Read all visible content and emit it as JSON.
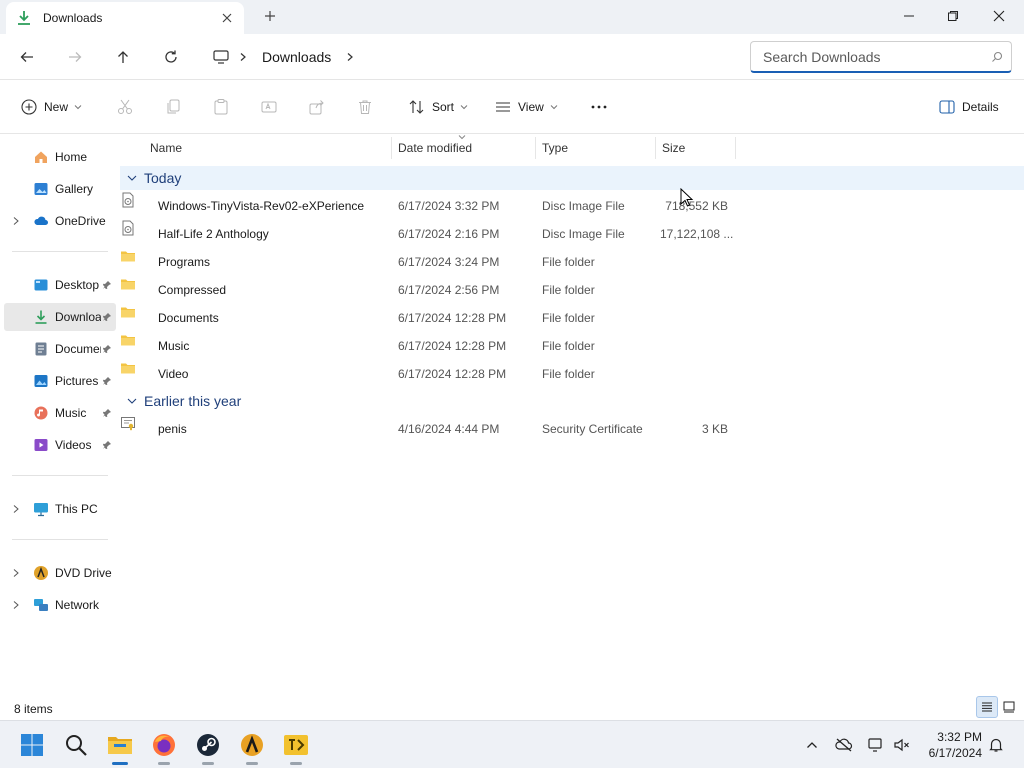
{
  "window": {
    "tab_title": "Downloads",
    "search_placeholder": "Search Downloads"
  },
  "breadcrumb": {
    "items": [
      "Downloads"
    ]
  },
  "toolbar": {
    "new_label": "New",
    "sort_label": "Sort",
    "view_label": "View",
    "details_label": "Details"
  },
  "sidebar": {
    "items": [
      {
        "label": "Home",
        "icon": "home-icon"
      },
      {
        "label": "Gallery",
        "icon": "gallery-icon"
      },
      {
        "label": "OneDrive",
        "icon": "cloud-icon"
      },
      {
        "label": "Desktop",
        "icon": "desktop-icon"
      },
      {
        "label": "Downloads",
        "icon": "download-icon"
      },
      {
        "label": "Documents",
        "icon": "documents-icon"
      },
      {
        "label": "Pictures",
        "icon": "pictures-icon"
      },
      {
        "label": "Music",
        "icon": "music-icon"
      },
      {
        "label": "Videos",
        "icon": "videos-icon"
      },
      {
        "label": "This PC",
        "icon": "monitor-icon"
      },
      {
        "label": "DVD Drive (",
        "icon": "dvd-drive-icon"
      },
      {
        "label": "Network",
        "icon": "network-icon"
      }
    ]
  },
  "columns": {
    "name": "Name",
    "date": "Date modified",
    "type": "Type",
    "size": "Size"
  },
  "groups": [
    {
      "label": "Today",
      "files": [
        {
          "name": "Windows-TinyVista-Rev02-eXPerience",
          "date": "6/17/2024 3:32 PM",
          "type": "Disc Image File",
          "size": "718,552 KB",
          "icon": "disc-image-icon"
        },
        {
          "name": "Half-Life 2 Anthology",
          "date": "6/17/2024 2:16 PM",
          "type": "Disc Image File",
          "size": "17,122,108 ...",
          "icon": "disc-image-icon"
        },
        {
          "name": "Programs",
          "date": "6/17/2024 3:24 PM",
          "type": "File folder",
          "size": "",
          "icon": "folder-icon"
        },
        {
          "name": "Compressed",
          "date": "6/17/2024 2:56 PM",
          "type": "File folder",
          "size": "",
          "icon": "folder-icon"
        },
        {
          "name": "Documents",
          "date": "6/17/2024 12:28 PM",
          "type": "File folder",
          "size": "",
          "icon": "folder-icon"
        },
        {
          "name": "Music",
          "date": "6/17/2024 12:28 PM",
          "type": "File folder",
          "size": "",
          "icon": "folder-icon"
        },
        {
          "name": "Video",
          "date": "6/17/2024 12:28 PM",
          "type": "File folder",
          "size": "",
          "icon": "folder-icon"
        }
      ]
    },
    {
      "label": "Earlier this year",
      "files": [
        {
          "name": "penis",
          "date": "4/16/2024 4:44 PM",
          "type": "Security Certificate",
          "size": "3 KB",
          "icon": "certificate-icon"
        }
      ]
    }
  ],
  "status": {
    "item_count": "8 items"
  },
  "taskbar": {
    "time": "3:32 PM",
    "date": "6/17/2024"
  },
  "colors": {
    "accent": "#1a5fb4",
    "folder": "#f3c443",
    "selection": "#e8e8e8",
    "group_highlight": "#eaf3fc"
  }
}
